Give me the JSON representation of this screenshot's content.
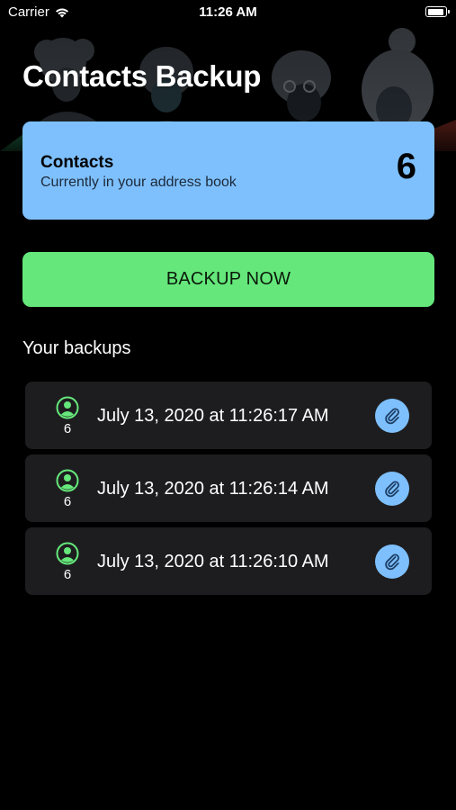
{
  "status_bar": {
    "carrier": "Carrier",
    "time": "11:26 AM"
  },
  "page": {
    "title": "Contacts Backup"
  },
  "contacts_card": {
    "title": "Contacts",
    "subtitle": "Currently in your address book",
    "count": "6"
  },
  "backup_button": {
    "label": "BACKUP NOW"
  },
  "backups_section": {
    "title": "Your backups",
    "items": [
      {
        "count": "6",
        "date": "July 13, 2020 at 11:26:17 AM"
      },
      {
        "count": "6",
        "date": "July 13, 2020 at 11:26:14 AM"
      },
      {
        "count": "6",
        "date": "July 13, 2020 at 11:26:10 AM"
      }
    ]
  },
  "colors": {
    "background": "#000000",
    "card_blue": "#7ec0fd",
    "button_green": "#65e77b",
    "row_background": "#1d1d1f",
    "person_icon_green": "#65e77b"
  },
  "icons": {
    "wifi": "wifi-icon",
    "battery": "battery-icon",
    "person": "person-circle-icon",
    "attachment": "paperclip-icon"
  }
}
